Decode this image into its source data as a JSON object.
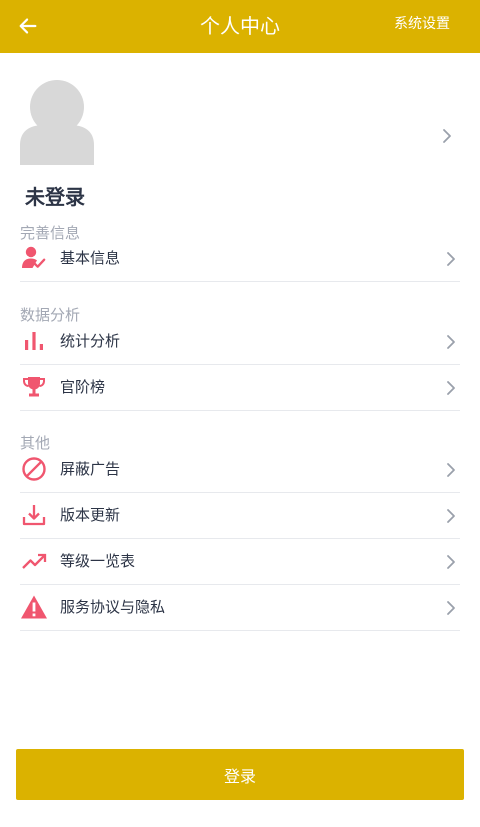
{
  "header": {
    "title": "个人中心",
    "settings_label": "系统设置",
    "back_icon": "arrow-left-icon",
    "background": "#dbb200"
  },
  "profile": {
    "username": "未登录",
    "avatar_icon": "default-avatar-icon"
  },
  "sections": [
    {
      "title": "完善信息",
      "items": [
        {
          "label": "基本信息",
          "icon": "user-check-icon"
        }
      ]
    },
    {
      "title": "数据分析",
      "items": [
        {
          "label": "统计分析",
          "icon": "bar-chart-icon"
        },
        {
          "label": "官阶榜",
          "icon": "trophy-icon"
        }
      ]
    },
    {
      "title": "其他",
      "items": [
        {
          "label": "屏蔽广告",
          "icon": "block-icon"
        },
        {
          "label": "版本更新",
          "icon": "download-icon"
        },
        {
          "label": "等级一览表",
          "icon": "trending-up-icon"
        },
        {
          "label": "服务协议与隐私",
          "icon": "warning-icon"
        }
      ]
    }
  ],
  "login_button": "登录",
  "colors": {
    "accent": "#dbb200",
    "icon": "#f0566f",
    "section_title": "#a3a8b4",
    "text": "#2c3446",
    "divider": "#e7e9ed"
  }
}
